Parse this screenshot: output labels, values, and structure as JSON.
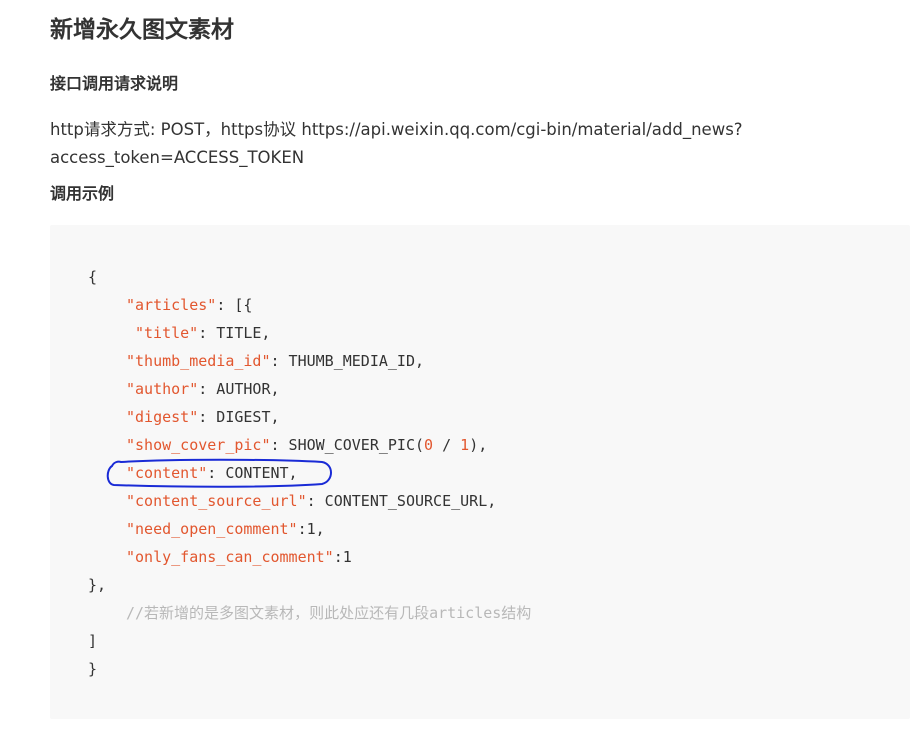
{
  "page": {
    "title": "新增永久图文素材",
    "section_interface": "接口调用请求说明",
    "request_desc_line1": "http请求方式: POST，https协议 https://api.weixin.qq.com/cgi-bin/material/add_news?",
    "request_desc_line2": "access_token=ACCESS_TOKEN",
    "section_example": "调用示例"
  },
  "code": {
    "open_brace": "{",
    "articles_key": "\"articles\"",
    "articles_rest": ": [{",
    "title_key": "\"title\"",
    "title_rest": ": TITLE,",
    "thumb_key": "\"thumb_media_id\"",
    "thumb_rest": ": THUMB_MEDIA_ID,",
    "author_key": "\"author\"",
    "author_rest": ": AUTHOR,",
    "digest_key": "\"digest\"",
    "digest_rest": ": DIGEST,",
    "showcover_key": "\"show_cover_pic\"",
    "showcover_rest_a": ": SHOW_COVER_PIC(",
    "showcover_zero": "0",
    "showcover_sep": " / ",
    "showcover_one": "1",
    "showcover_rest_b": "),",
    "content_key": "\"content\"",
    "content_rest": ": CONTENT,",
    "source_key": "\"content_source_url\"",
    "source_rest": ": CONTENT_SOURCE_URL,",
    "open_comment_key": "\"need_open_comment\"",
    "open_comment_rest": ":1,",
    "fans_key": "\"only_fans_can_comment\"",
    "fans_rest": ":1",
    "close_item": "},",
    "comment": "//若新增的是多图文素材，则此处应还有几段articles结构",
    "close_array": "]",
    "close_brace": "}"
  },
  "colors": {
    "key": "#e2572f",
    "comment": "#b8b8b8",
    "code_bg": "#f8f8f8",
    "annotation": "#1a2bd6"
  }
}
